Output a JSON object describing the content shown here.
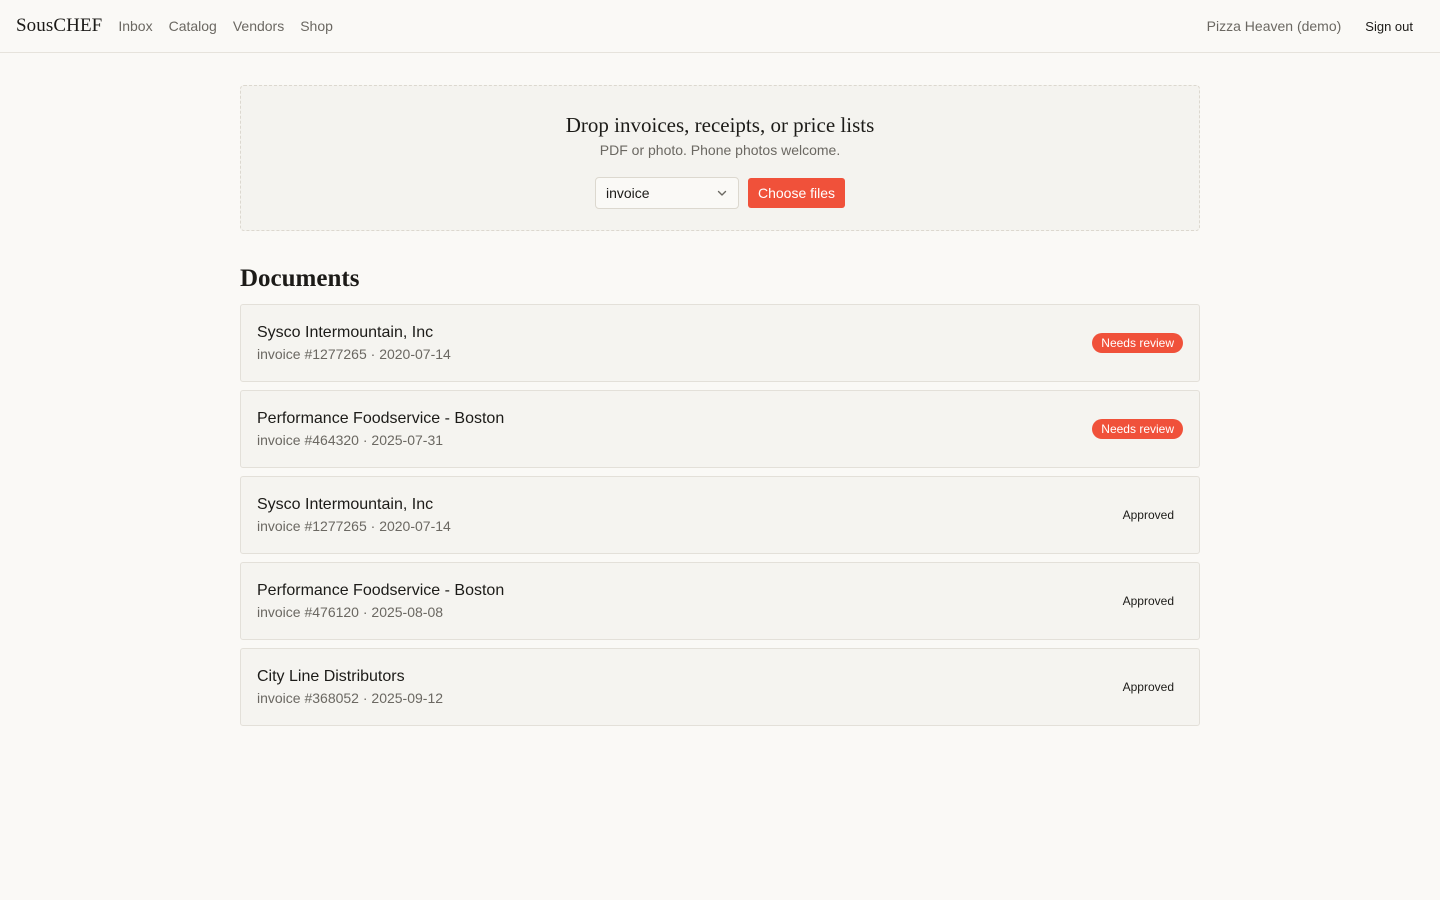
{
  "brand": "SousCHEF",
  "nav": [
    "Inbox",
    "Catalog",
    "Vendors",
    "Shop"
  ],
  "org": "Pizza Heaven (demo)",
  "sign_out": "Sign out",
  "upload": {
    "title": "Drop invoices, receipts, or price lists",
    "subtitle": "PDF or photo. Phone photos welcome.",
    "type_selected": "invoice",
    "choose_label": "Choose files"
  },
  "documents_title": "Documents",
  "documents": [
    {
      "vendor": "Sysco Intermountain, Inc",
      "meta": "invoice #1277265 · 2020-07-14",
      "status": "Needs review",
      "kind": "review"
    },
    {
      "vendor": "Performance Foodservice - Boston",
      "meta": "invoice #464320 · 2025-07-31",
      "status": "Needs review",
      "kind": "review"
    },
    {
      "vendor": "Sysco Intermountain, Inc",
      "meta": "invoice #1277265 · 2020-07-14",
      "status": "Approved",
      "kind": "approved"
    },
    {
      "vendor": "Performance Foodservice - Boston",
      "meta": "invoice #476120 · 2025-08-08",
      "status": "Approved",
      "kind": "approved"
    },
    {
      "vendor": "City Line Distributors",
      "meta": "invoice #368052 · 2025-09-12",
      "status": "Approved",
      "kind": "approved"
    }
  ],
  "colors": {
    "accent": "#f0513a",
    "background": "#faf9f6"
  }
}
